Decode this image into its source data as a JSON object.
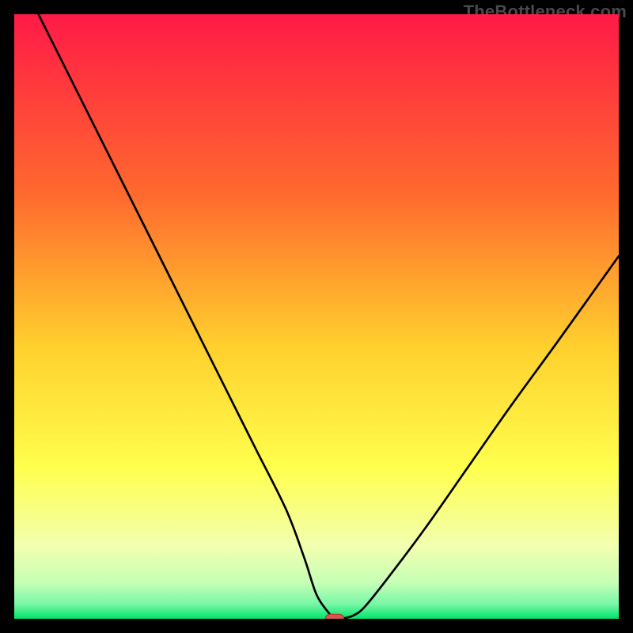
{
  "watermark": "TheBottleneck.com",
  "colors": {
    "bg": "#000000",
    "grad_top": "#ff1a47",
    "grad_mid1": "#ff8f2e",
    "grad_mid2": "#ffe52e",
    "grad_mid3": "#f7ff7a",
    "grad_low": "#d8ffba",
    "grad_bottom": "#00e56a",
    "curve": "#000000",
    "marker_fill": "#d9564e",
    "marker_stroke": "#b03b34"
  },
  "chart_data": {
    "type": "line",
    "title": "",
    "xlabel": "",
    "ylabel": "",
    "xlim": [
      0,
      100
    ],
    "ylim": [
      0,
      100
    ],
    "series": [
      {
        "name": "bottleneck-curve",
        "x": [
          4,
          10,
          15,
          20,
          25,
          30,
          35,
          40,
          45,
          48,
          50,
          52,
          53,
          54,
          56,
          58,
          62,
          68,
          75,
          82,
          90,
          100
        ],
        "values": [
          100,
          88,
          78,
          68,
          58,
          48,
          38,
          28,
          18,
          10,
          4,
          1,
          0,
          0,
          0.5,
          2,
          7,
          15,
          25,
          35,
          46,
          60
        ]
      }
    ],
    "marker": {
      "x": 53,
      "y": 0
    },
    "gradient_stops": [
      {
        "pos": 0.0,
        "color": "#ff1a47"
      },
      {
        "pos": 0.3,
        "color": "#ff6a2e"
      },
      {
        "pos": 0.55,
        "color": "#ffd02e"
      },
      {
        "pos": 0.75,
        "color": "#ffff4d"
      },
      {
        "pos": 0.88,
        "color": "#f2ffb0"
      },
      {
        "pos": 0.94,
        "color": "#c6ffb5"
      },
      {
        "pos": 0.975,
        "color": "#7bf7a8"
      },
      {
        "pos": 1.0,
        "color": "#00e56a"
      }
    ]
  }
}
